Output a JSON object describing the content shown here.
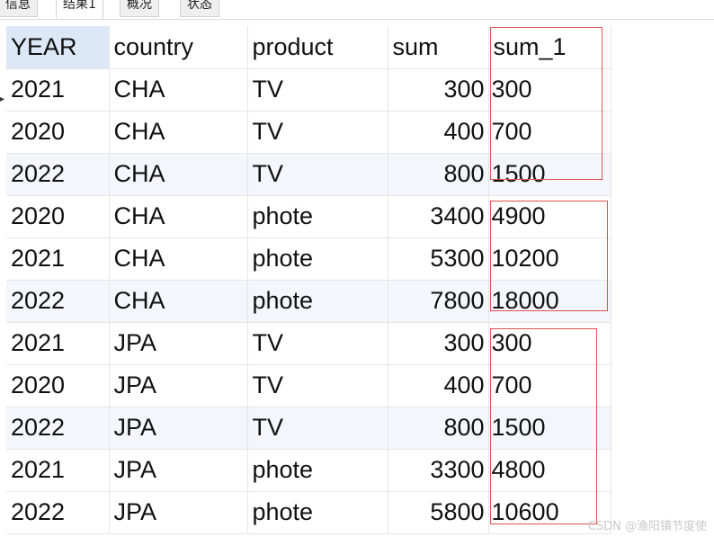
{
  "tabs": [
    "信息",
    "结果1",
    "概况",
    "状态"
  ],
  "row_marker": "▸",
  "columns": [
    "YEAR",
    "country",
    "product",
    "sum",
    "sum_1"
  ],
  "rows": [
    [
      "2021",
      "CHA",
      "TV",
      "300",
      "300"
    ],
    [
      "2020",
      "CHA",
      "TV",
      "400",
      "700"
    ],
    [
      "2022",
      "CHA",
      "TV",
      "800",
      "1500"
    ],
    [
      "2020",
      "CHA",
      "phote",
      "3400",
      "4900"
    ],
    [
      "2021",
      "CHA",
      "phote",
      "5300",
      "10200"
    ],
    [
      "2022",
      "CHA",
      "phote",
      "7800",
      "18000"
    ],
    [
      "2021",
      "JPA",
      "TV",
      "300",
      "300"
    ],
    [
      "2020",
      "JPA",
      "TV",
      "400",
      "700"
    ],
    [
      "2022",
      "JPA",
      "TV",
      "800",
      "1500"
    ],
    [
      "2021",
      "JPA",
      "phote",
      "3300",
      "4800"
    ],
    [
      "2022",
      "JPA",
      "phote",
      "5800",
      "10600"
    ]
  ],
  "watermark": "CSDN @渔阳镇节度使",
  "colors": {
    "highlight": "#e05050",
    "selected_header": "#dce8f5",
    "alt_row": "#f3f6fb"
  }
}
